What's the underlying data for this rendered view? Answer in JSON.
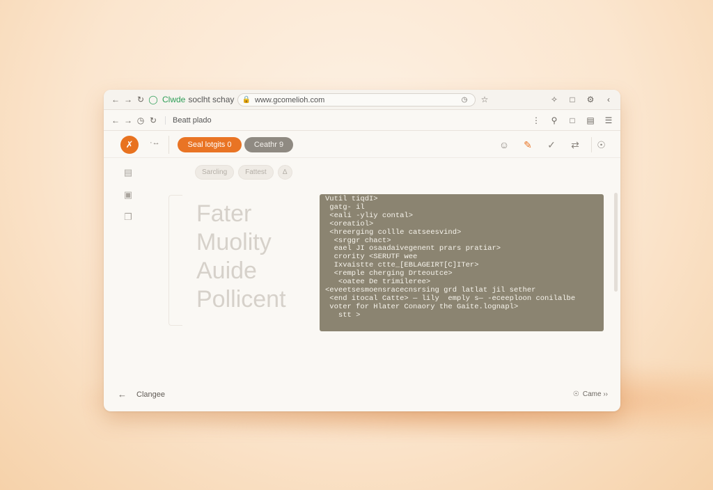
{
  "browser": {
    "brand": "Clwde",
    "brand_rest": "soclht schay",
    "url": "www.gcomelioh.com",
    "page_title": "Beatt plado",
    "icons": [
      "back-arrow-icon",
      "forward-arrow-icon",
      "reload-icon",
      "lock-icon",
      "timer-icon",
      "star-icon",
      "extensions-icon",
      "tab-icon",
      "settings-icon",
      "menu-icon"
    ],
    "window_marks": {
      "min": "‹",
      "max": "›"
    }
  },
  "toolbar": {
    "arrows": "·↔",
    "logo_glyph": "✗",
    "primary_pill": "Seal lotgits 0",
    "secondary_pill": "Ceathr 9"
  },
  "chips": {
    "first": "Sarcling",
    "second": "Fattest",
    "third_glyph": "∆"
  },
  "content": {
    "title_lines": [
      "Fater",
      "Muolity",
      "Auide",
      "Pollicent"
    ],
    "code": "Vutil tiqdI>\n gatg- il\n <eali -yliy contal>\n <oreatiol>\n <hreerging collle catseesvind>\n  <srggr chact>\n  eael JI osaadaivegenent prars pratiar>\n  crority <SERUTF wee\n  Ixvaistte ctte_[EBLAGEIRT[C]ITer>\n  <remple cherging Drteoutce>\n   <oatee De trimileree>\n<eveetsesmoensracecnsrsing grd latlat jil sether\n <end itocal Catte> — lily  emply s— -eceeploon conilalbe\n voter for Hlater Conaory the Gaite.lognapl>\n   stt >"
  },
  "footer": {
    "back_label": "Clangee",
    "next_label": "Came ››"
  },
  "colors": {
    "accent": "#e97424",
    "code_bg": "#8b8471",
    "brand_green": "#2e9e57"
  }
}
